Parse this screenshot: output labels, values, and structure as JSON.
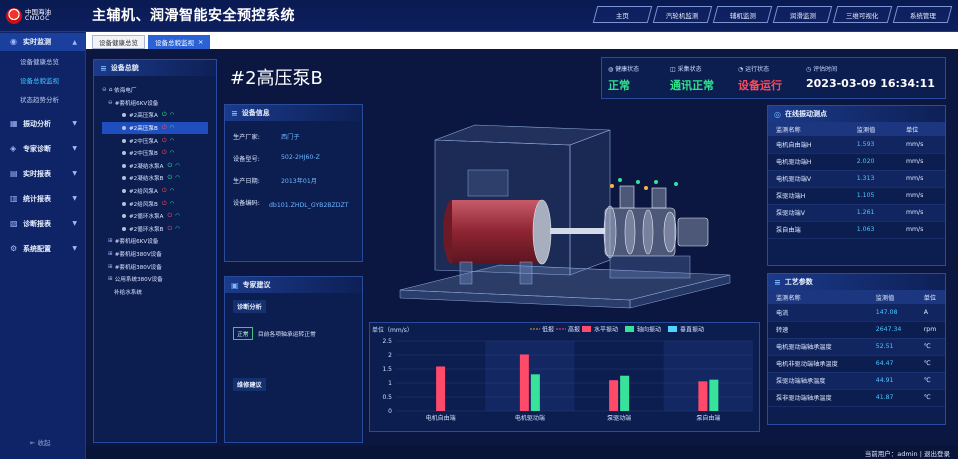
{
  "header": {
    "logo_cn": "中国海油",
    "logo_en": "CNOOC",
    "title": "主辅机、润滑智能安全预控系统",
    "nav": [
      "主页",
      "汽轮机监测",
      "辅机监测",
      "润滑监测",
      "三维可视化",
      "系统管理"
    ]
  },
  "sidebar": {
    "groups": [
      {
        "label": "实时监测",
        "items": [
          "设备健康总览",
          "设备总貌监视",
          "状态趋势分析"
        ]
      },
      {
        "label": "振动分析"
      },
      {
        "label": "专家诊断"
      },
      {
        "label": "实时报表"
      },
      {
        "label": "统计报表"
      },
      {
        "label": "诊断报表"
      },
      {
        "label": "系统配置"
      }
    ],
    "collapse": "收起"
  },
  "tabs": [
    {
      "label": "设备健康总览"
    },
    {
      "label": "设备总貌监视"
    }
  ],
  "tree": {
    "title": "设备总貌",
    "root": "依海电厂",
    "group1": "#套机组6KV设备",
    "pumps": [
      {
        "label": "#2高压泵A",
        "state": "on"
      },
      {
        "label": "#2高压泵B",
        "state": "off"
      },
      {
        "label": "#2中压泵A",
        "state": "off"
      },
      {
        "label": "#2中压泵B",
        "state": "off"
      },
      {
        "label": "#2凝结水泵A",
        "state": "on"
      },
      {
        "label": "#2凝结水泵B",
        "state": "on"
      },
      {
        "label": "#2给风泵A",
        "state": "off"
      },
      {
        "label": "#2给风泵B",
        "state": "off"
      },
      {
        "label": "#2循环水泵A",
        "state": "off"
      },
      {
        "label": "#2循环水泵B",
        "state": "off"
      }
    ],
    "groups": [
      "#套机组6KV设备",
      "#套机组380V设备",
      "#套机组380V设备",
      "公用系统380V设备",
      "补给水系统"
    ]
  },
  "device_info": {
    "title": "设备信息",
    "rows": [
      {
        "k": "生产厂家:",
        "v": "西门子"
      },
      {
        "k": "设备型号:",
        "v": "502-2HJ60-Z"
      },
      {
        "k": "生产日期:",
        "v": "2013年01月"
      },
      {
        "k": "设备编码:",
        "v": "db101.ZHDL_GYB2BZDZT"
      }
    ]
  },
  "expert": {
    "title": "专家建议",
    "diag_label": "诊断分析",
    "status": "正常",
    "status_text": "目前各项轴承运转正常",
    "maint_label": "维修建议"
  },
  "machine": {
    "name": "#2高压泵B"
  },
  "status": {
    "health_label": "健康状态",
    "health_value": "正常",
    "collect_label": "采集状态",
    "collect_value": "通讯正常",
    "run_label": "运行状态",
    "run_value": "设备运行",
    "time_label": "评估时间",
    "time_value": "2023-03-09 16:34:11",
    "colors": {
      "health": "#2fe38b",
      "collect": "#2fe38b",
      "run": "#ff4a5c",
      "time": "#ffffff"
    }
  },
  "vibration": {
    "title": "在线振动测点",
    "headers": [
      "监测名称",
      "监测值",
      "单位"
    ],
    "rows": [
      [
        "电机自由端H",
        "1.593",
        "mm/s"
      ],
      [
        "电机驱动端H",
        "2.020",
        "mm/s"
      ],
      [
        "电机驱动端V",
        "1.313",
        "mm/s"
      ],
      [
        "泵驱动端H",
        "1.105",
        "mm/s"
      ],
      [
        "泵驱动端V",
        "1.261",
        "mm/s"
      ],
      [
        "泵自由端",
        "1.063",
        "mm/s"
      ]
    ]
  },
  "process": {
    "title": "工艺参数",
    "headers": [
      "监测名称",
      "监测值",
      "单位"
    ],
    "rows": [
      [
        "电流",
        "147.08",
        "A"
      ],
      [
        "转速",
        "2647.34",
        "rpm"
      ],
      [
        "电机驱动端轴承温度",
        "52.51",
        "℃"
      ],
      [
        "电机非驱动端轴承温度",
        "64.47",
        "℃"
      ],
      [
        "泵驱动端轴承温度",
        "44.91",
        "℃"
      ],
      [
        "泵非驱动端轴承温度",
        "41.87",
        "℃"
      ]
    ]
  },
  "chart_data": {
    "type": "bar",
    "ylabel": "单位（mm/s）",
    "ylim": [
      0,
      2.5
    ],
    "yticks": [
      "0",
      "0.5",
      "1",
      "1.5",
      "2",
      "2.5"
    ],
    "categories": [
      "电机自由端",
      "电机驱动端",
      "泵驱动端",
      "泵自由端"
    ],
    "legend": [
      "低报",
      "高报",
      "水平振动",
      "轴向振动",
      "垂直振动"
    ],
    "series": [
      {
        "name": "水平振动",
        "color": "#ff4a6a",
        "values": [
          1.59,
          2.02,
          1.1,
          1.06
        ]
      },
      {
        "name": "轴向振动",
        "color": "#37e29a",
        "values": [
          null,
          1.31,
          1.26,
          1.12
        ]
      },
      {
        "name": "垂直振动",
        "color": "#4fd3ff",
        "values": [
          null,
          null,
          null,
          null
        ]
      }
    ]
  },
  "footer": {
    "user": "当前用户：admin  |  退出登录"
  }
}
